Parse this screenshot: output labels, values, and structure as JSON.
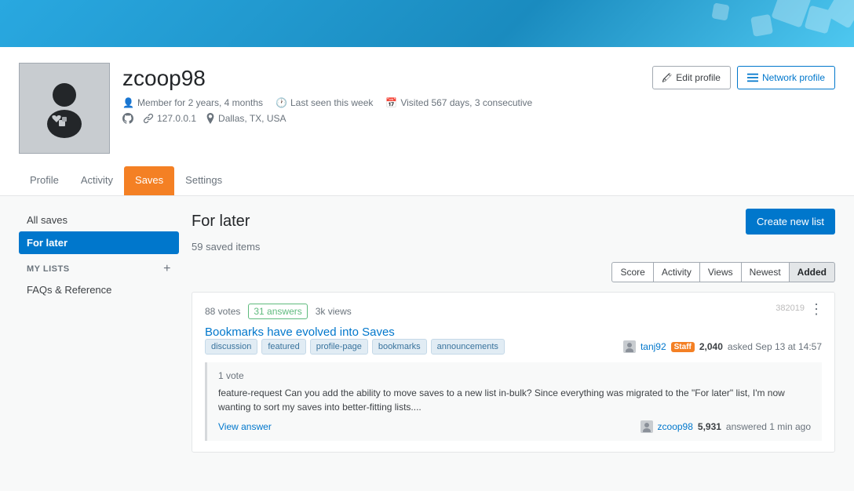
{
  "banner": {
    "height": 60
  },
  "header": {
    "username": "zcoop98",
    "meta": [
      {
        "icon": "member-icon",
        "text": "Member for 2 years, 4 months"
      },
      {
        "icon": "clock-icon",
        "text": "Last seen this week"
      },
      {
        "icon": "calendar-icon",
        "text": "Visited 567 days, 3 consecutive"
      }
    ],
    "links": [
      {
        "icon": "github-icon",
        "text": ""
      },
      {
        "icon": "link-icon",
        "text": "127.0.0.1"
      },
      {
        "icon": "location-icon",
        "text": "Dallas, TX, USA"
      }
    ],
    "buttons": {
      "edit_profile": "Edit profile",
      "network_profile": "Network profile"
    }
  },
  "nav": {
    "tabs": [
      {
        "id": "profile",
        "label": "Profile"
      },
      {
        "id": "activity",
        "label": "Activity"
      },
      {
        "id": "saves",
        "label": "Saves",
        "active": true
      },
      {
        "id": "settings",
        "label": "Settings"
      }
    ]
  },
  "sidebar": {
    "all_saves_label": "All saves",
    "for_later_label": "For later",
    "my_lists_label": "MY LISTS",
    "plus_label": "+",
    "lists": [
      {
        "label": "FAQs & Reference"
      }
    ]
  },
  "content": {
    "title": "For later",
    "create_list_btn": "Create new list",
    "saved_count": "59 saved items",
    "sort_tabs": [
      {
        "label": "Score"
      },
      {
        "label": "Activity"
      },
      {
        "label": "Views"
      },
      {
        "label": "Newest"
      },
      {
        "label": "Added",
        "active": true
      }
    ],
    "questions": [
      {
        "id": "382019",
        "votes": "88 votes",
        "answers": "31 answers",
        "views": "3k views",
        "title": "Bookmarks have evolved into Saves",
        "tags": [
          "discussion",
          "featured",
          "profile-page",
          "bookmarks",
          "announcements"
        ],
        "asked_by": "tanj92",
        "staff_badge": "Staff",
        "rep": "2,040",
        "asked_time": "asked Sep 13 at 14:57",
        "answer_preview": {
          "votes": "1 vote",
          "text": "feature-request Can you add the ability to move saves to a new list in-bulk? Since everything was migrated to the \"For later\" list, I'm now wanting to sort my saves into better-fitting lists....",
          "view_answer_label": "View answer",
          "answered_by": "zcoop98",
          "answered_rep": "5,931",
          "answered_time": "answered 1 min ago"
        }
      }
    ]
  }
}
